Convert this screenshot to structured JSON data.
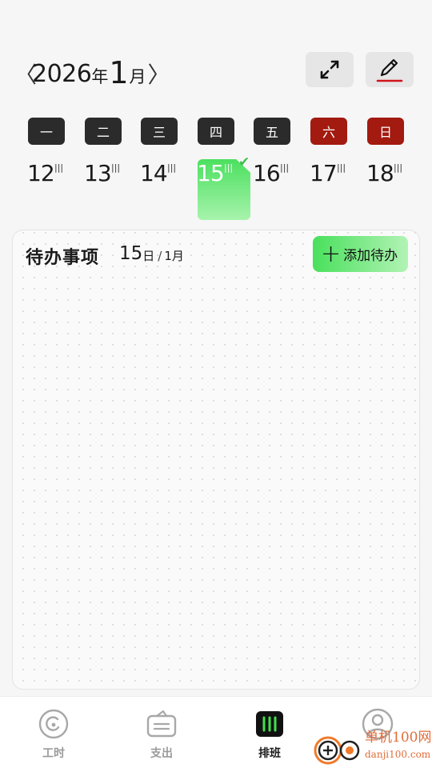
{
  "header": {
    "prev_icon": "chevron-left-icon",
    "next_icon": "chevron-right-icon",
    "prev_glyph": "〈",
    "next_glyph": "〉",
    "year": "2026",
    "year_unit": "年",
    "month": "1",
    "month_unit": "月",
    "expand_icon": "expand-arrows-icon",
    "edit_icon": "pencil-icon"
  },
  "week": {
    "weekdays": [
      {
        "label": "一",
        "weekend": false
      },
      {
        "label": "二",
        "weekend": false
      },
      {
        "label": "三",
        "weekend": false
      },
      {
        "label": "四",
        "weekend": false
      },
      {
        "label": "五",
        "weekend": false
      },
      {
        "label": "六",
        "weekend": true
      },
      {
        "label": "日",
        "weekend": true
      }
    ],
    "days": [
      {
        "date": "12",
        "lunar": "|||"
      },
      {
        "date": "13",
        "lunar": "|||"
      },
      {
        "date": "14",
        "lunar": "|||"
      },
      {
        "date": "15",
        "lunar": "|||",
        "selected": true,
        "checked": true
      },
      {
        "date": "16",
        "lunar": "|||"
      },
      {
        "date": "17",
        "lunar": "|||"
      },
      {
        "date": "18",
        "lunar": "|||"
      }
    ],
    "check_glyph": "✔"
  },
  "todo": {
    "title": "待办事项",
    "day": "15",
    "day_unit": "日",
    "separator": "/",
    "month_label": "1月",
    "add_icon": "plus-icon",
    "add_glyph": "+",
    "add_label": "添加待办"
  },
  "nav": {
    "items": [
      {
        "label": "工时",
        "icon": "clock-circle-icon",
        "active": false
      },
      {
        "label": "支出",
        "icon": "wallet-icon",
        "active": false
      },
      {
        "label": "排班",
        "icon": "schedule-icon",
        "active": true
      },
      {
        "label": "",
        "icon": "profile-icon",
        "active": false
      }
    ]
  },
  "watermark": {
    "text": "单机100网",
    "url": "danji100.com"
  },
  "colors": {
    "accent_green": "#4be05f",
    "weekend_red": "#a31a10",
    "chip_dark": "#2b2b2b",
    "edit_underline": "#d0141c"
  }
}
